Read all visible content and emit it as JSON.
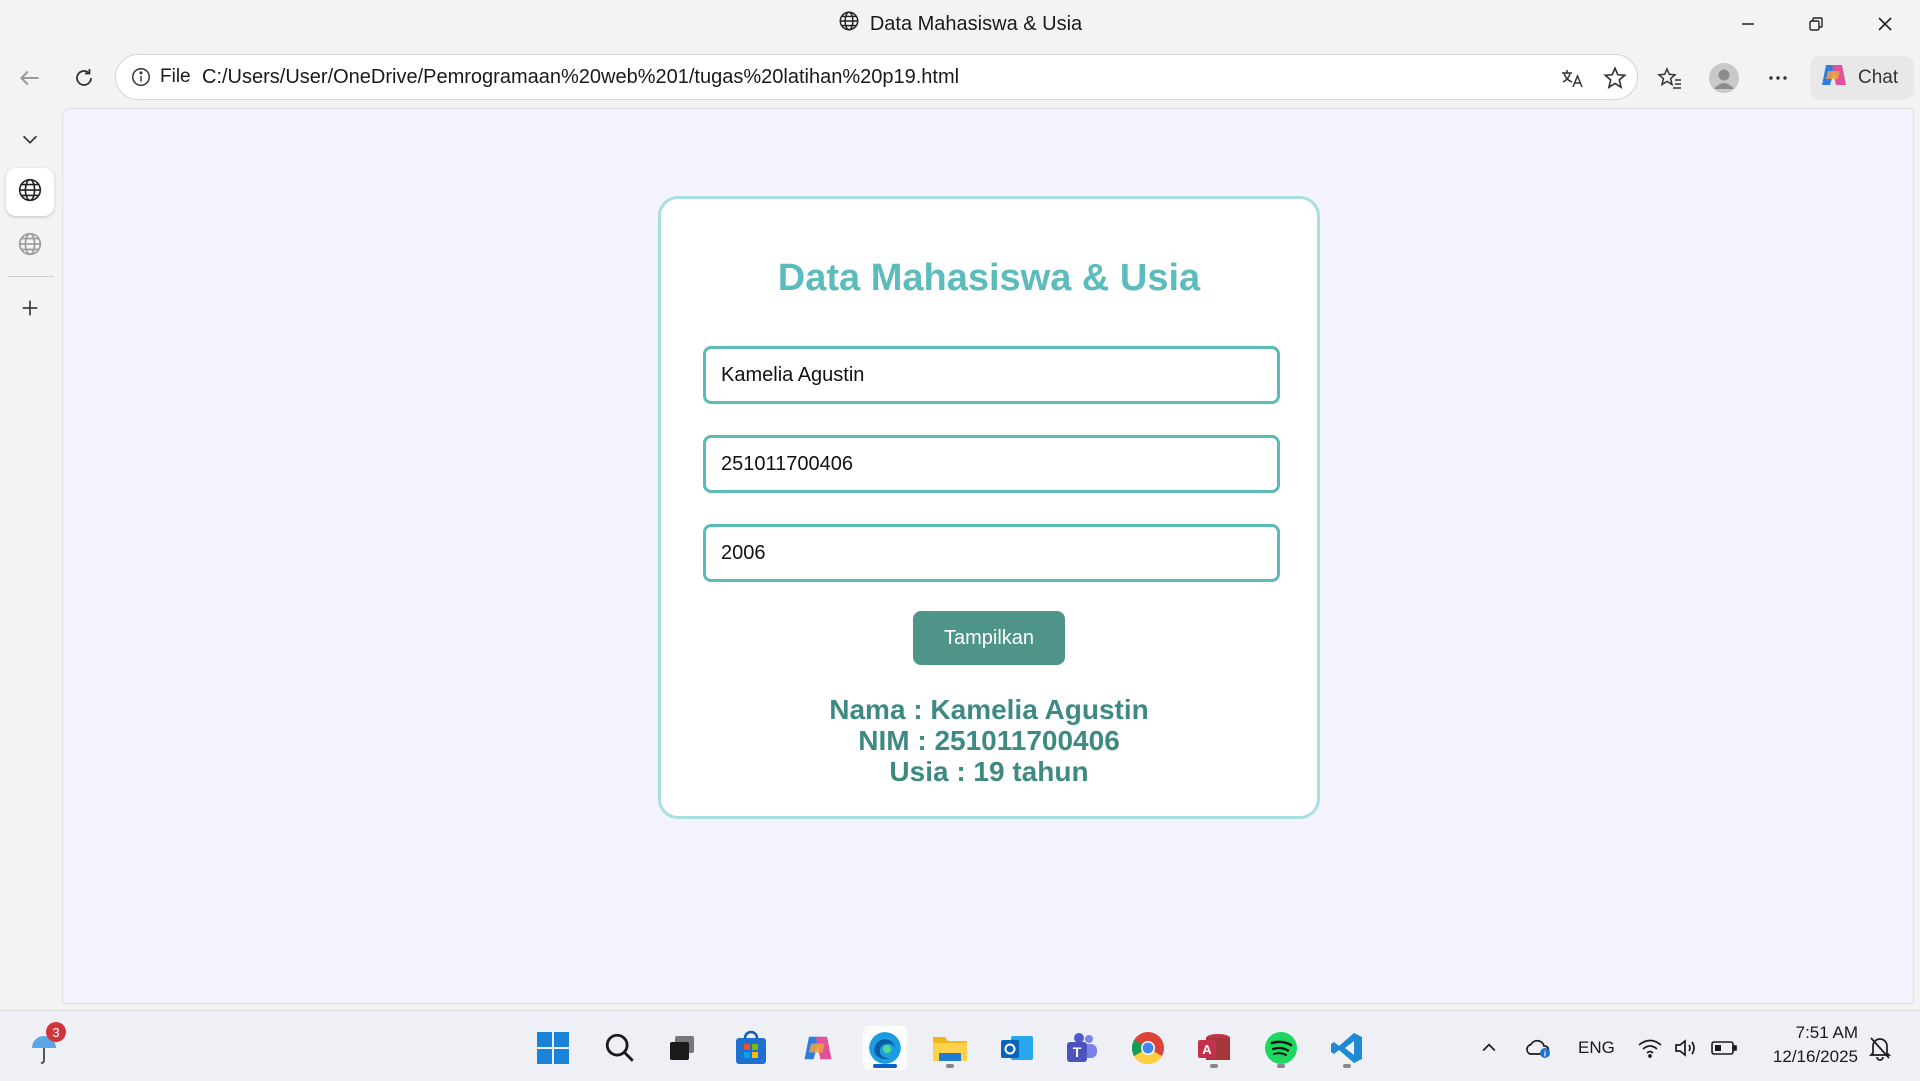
{
  "window": {
    "title": "Data Mahasiswa & Usia"
  },
  "address_bar": {
    "scheme_label": "File",
    "url": "C:/Users/User/OneDrive/Pemrogramaan%20web%201/tugas%20latihan%20p19.html"
  },
  "toolbar": {
    "chat_label": "Chat"
  },
  "page": {
    "heading": "Data Mahasiswa & Usia",
    "form": {
      "name_value": "Kamelia Agustin",
      "nim_value": "251011700406",
      "year_value": "2006",
      "button_label": "Tampilkan"
    },
    "result": {
      "name_line": "Nama : Kamelia Agustin",
      "nim_line": "NIM : 251011700406",
      "age_line": "Usia : 19 tahun"
    }
  },
  "taskbar": {
    "notification_badge": "3",
    "language": "ENG",
    "time": "7:51 AM",
    "date": "12/16/2025"
  },
  "colors": {
    "heading": "#5cbcbc",
    "card_border": "#a8dfe0",
    "input_border": "#5bbbb6",
    "button": "#4e9488",
    "result_text": "#3e8a82",
    "page_bg": "#f4f2fc"
  }
}
